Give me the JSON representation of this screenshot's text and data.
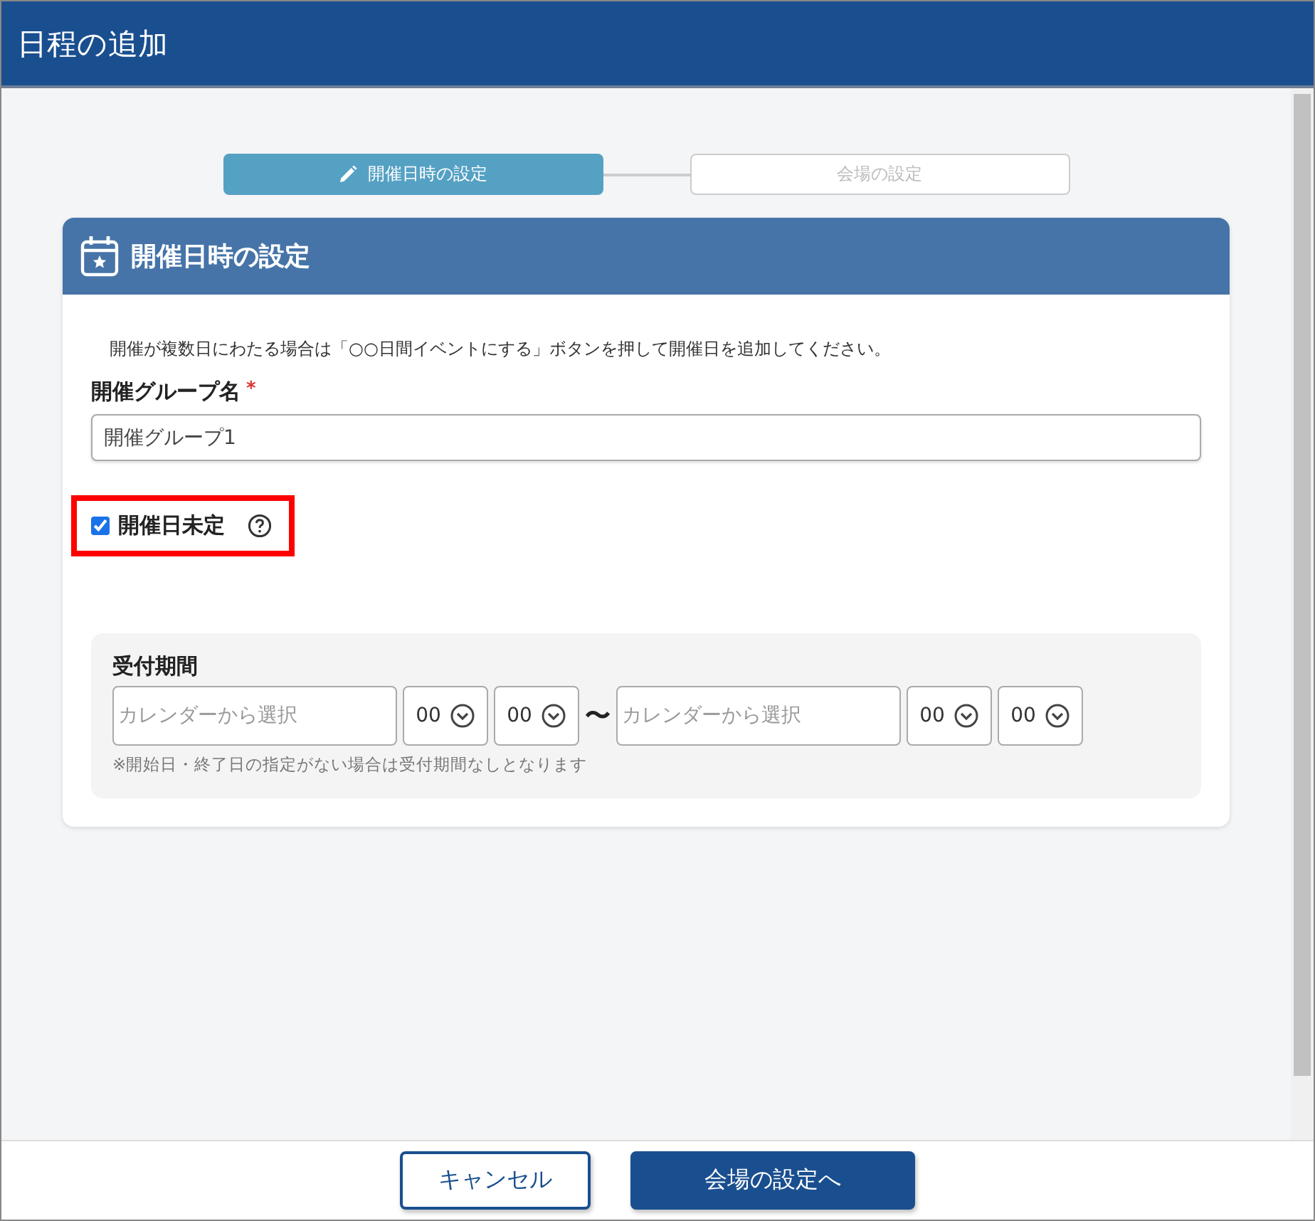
{
  "window": {
    "title": "日程の追加"
  },
  "steps": [
    {
      "label": "開催日時の設定",
      "selected": true
    },
    {
      "label": "会場の設定",
      "selected": false
    }
  ],
  "section": {
    "title": "開催日時の設定"
  },
  "note": "開催が複数日にわたる場合は「○○日間イベントにする」ボタンを押して開催日を追加してください。",
  "group_name": {
    "label": "開催グループ名",
    "required_mark": "*",
    "value": "開催グループ1"
  },
  "undecided": {
    "label": "開催日未定",
    "checked": true,
    "highlighted": true
  },
  "period": {
    "label": "受付期間",
    "start": {
      "placeholder": "カレンダーから選択",
      "hour": "00",
      "minute": "00"
    },
    "separator": "〜",
    "end": {
      "placeholder": "カレンダーから選択",
      "hour": "00",
      "minute": "00"
    },
    "hint": "※開始日・終了日の指定がない場合は受付期間なしとなります"
  },
  "buttons": [
    {
      "label": "キャンセル",
      "kind": "secondary"
    },
    {
      "label": "会場の設定へ",
      "kind": "primary"
    }
  ]
}
